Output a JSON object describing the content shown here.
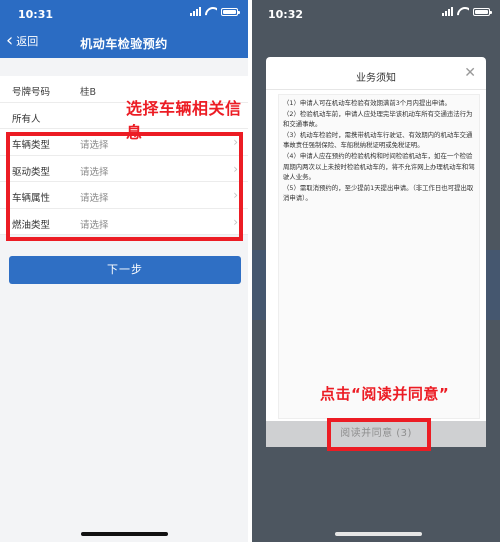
{
  "left": {
    "status": {
      "time": "10:31"
    },
    "nav": {
      "back_label": "返回",
      "title": "机动车检验预约"
    },
    "form_rows": [
      {
        "label": "号牌号码",
        "value": "桂B",
        "placeholder": ""
      },
      {
        "label": "所有人",
        "value": "",
        "placeholder": ""
      },
      {
        "label": "车辆类型",
        "value": "",
        "placeholder": "请选择"
      },
      {
        "label": "驱动类型",
        "value": "",
        "placeholder": "请选择"
      },
      {
        "label": "车辆属性",
        "value": "",
        "placeholder": "请选择"
      },
      {
        "label": "燃油类型",
        "value": "",
        "placeholder": "请选择"
      }
    ],
    "annotation": "选择车辆相关信息",
    "next_button": "下一步"
  },
  "right": {
    "status": {
      "time": "10:32"
    },
    "modal": {
      "title": "业务须知",
      "paragraphs": [
        "（1）申请人可在机动车检验有效期满前3个月内提出申请。",
        "（2）检验机动车前，申请人应处理完毕该机动车所有交通违法行为和交通事故。",
        "（3）机动车检验时，需携带机动车行驶证、有效期内的机动车交通事故责任强制保险、车船税纳税证明或免税证明。",
        "（4）申请人应在预约的检验机构和时间检验机动车，如在一个检验周期内两次以上未按时检验机动车的，将不允许网上办理机动车和驾驶人业务。",
        "（5）需取消预约的，至少提前1天提出申请。（非工作日也可提出取消申请）。"
      ],
      "agree_button": "阅读并同意 (3)"
    },
    "annotation": "点击“阅读并同意”"
  },
  "colors": {
    "header_blue": "#2b6cc3",
    "button_blue": "#2f6fc4",
    "annotation_red": "#ec1c24",
    "overlay_gray": "#4d5660"
  },
  "icons": [
    "back-chevron-icon",
    "signal-icon",
    "wifi-icon",
    "battery-icon",
    "chevron-right-icon",
    "close-icon"
  ]
}
